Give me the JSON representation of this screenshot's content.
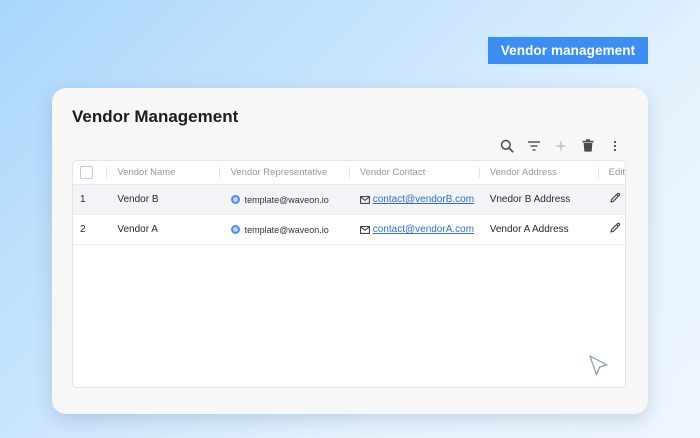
{
  "badge": {
    "label": "Vendor management"
  },
  "card": {
    "title": "Vendor Management",
    "toolbar": [
      "search-icon",
      "filter-icon",
      "plus-icon",
      "trash-icon",
      "more-vertical-icon"
    ]
  },
  "table": {
    "columns": [
      "",
      "Vendor Name",
      "Vendor Representative",
      "Vendor Contact",
      "Vendor Address",
      "Edit"
    ],
    "rows": [
      {
        "index": "1",
        "name": "Vendor B",
        "representative": "template@waveon.io",
        "contact": "contact@vendorB.com",
        "address": "Vnedor B Address"
      },
      {
        "index": "2",
        "name": "Vendor A",
        "representative": "template@waveon.io",
        "contact": "contact@vendorA.com",
        "address": "Vendor A Address"
      }
    ]
  },
  "colors": {
    "accent": "#3c8ef3",
    "link": "#2f6fd4",
    "row_highlight": "#f2f4f7"
  }
}
